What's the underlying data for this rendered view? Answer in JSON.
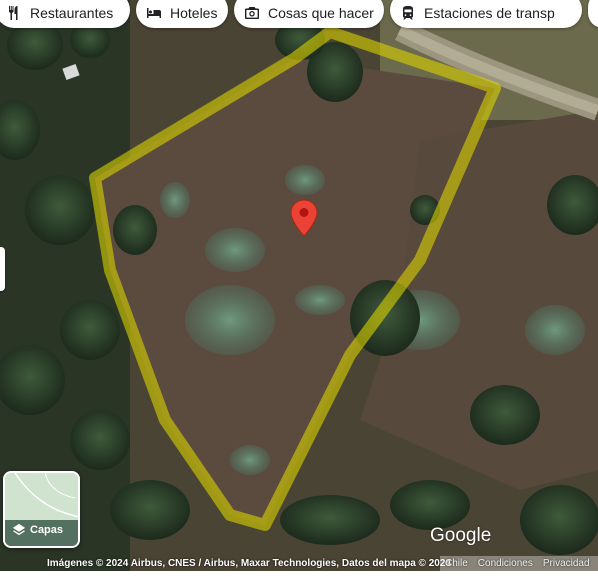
{
  "chips": [
    {
      "label": "Restaurantes",
      "icon": "fork-knife-icon"
    },
    {
      "label": "Hoteles",
      "icon": "bed-icon"
    },
    {
      "label": "Cosas que hacer",
      "icon": "camera-icon"
    },
    {
      "label": "Estaciones de transp",
      "icon": "train-icon"
    }
  ],
  "layers": {
    "label": "Capas",
    "icon": "layers-icon"
  },
  "logo": "Google",
  "footer": {
    "attribution": "Imágenes © 2024 Airbus, CNES / Airbus, Maxar Technologies, Datos del mapa © 2024",
    "country": "Chile",
    "terms": "Condiciones",
    "privacy": "Privacidad"
  },
  "marker": {
    "icon": "map-pin-icon",
    "color": "#ea4335"
  },
  "boundary_color": "#d8d200"
}
